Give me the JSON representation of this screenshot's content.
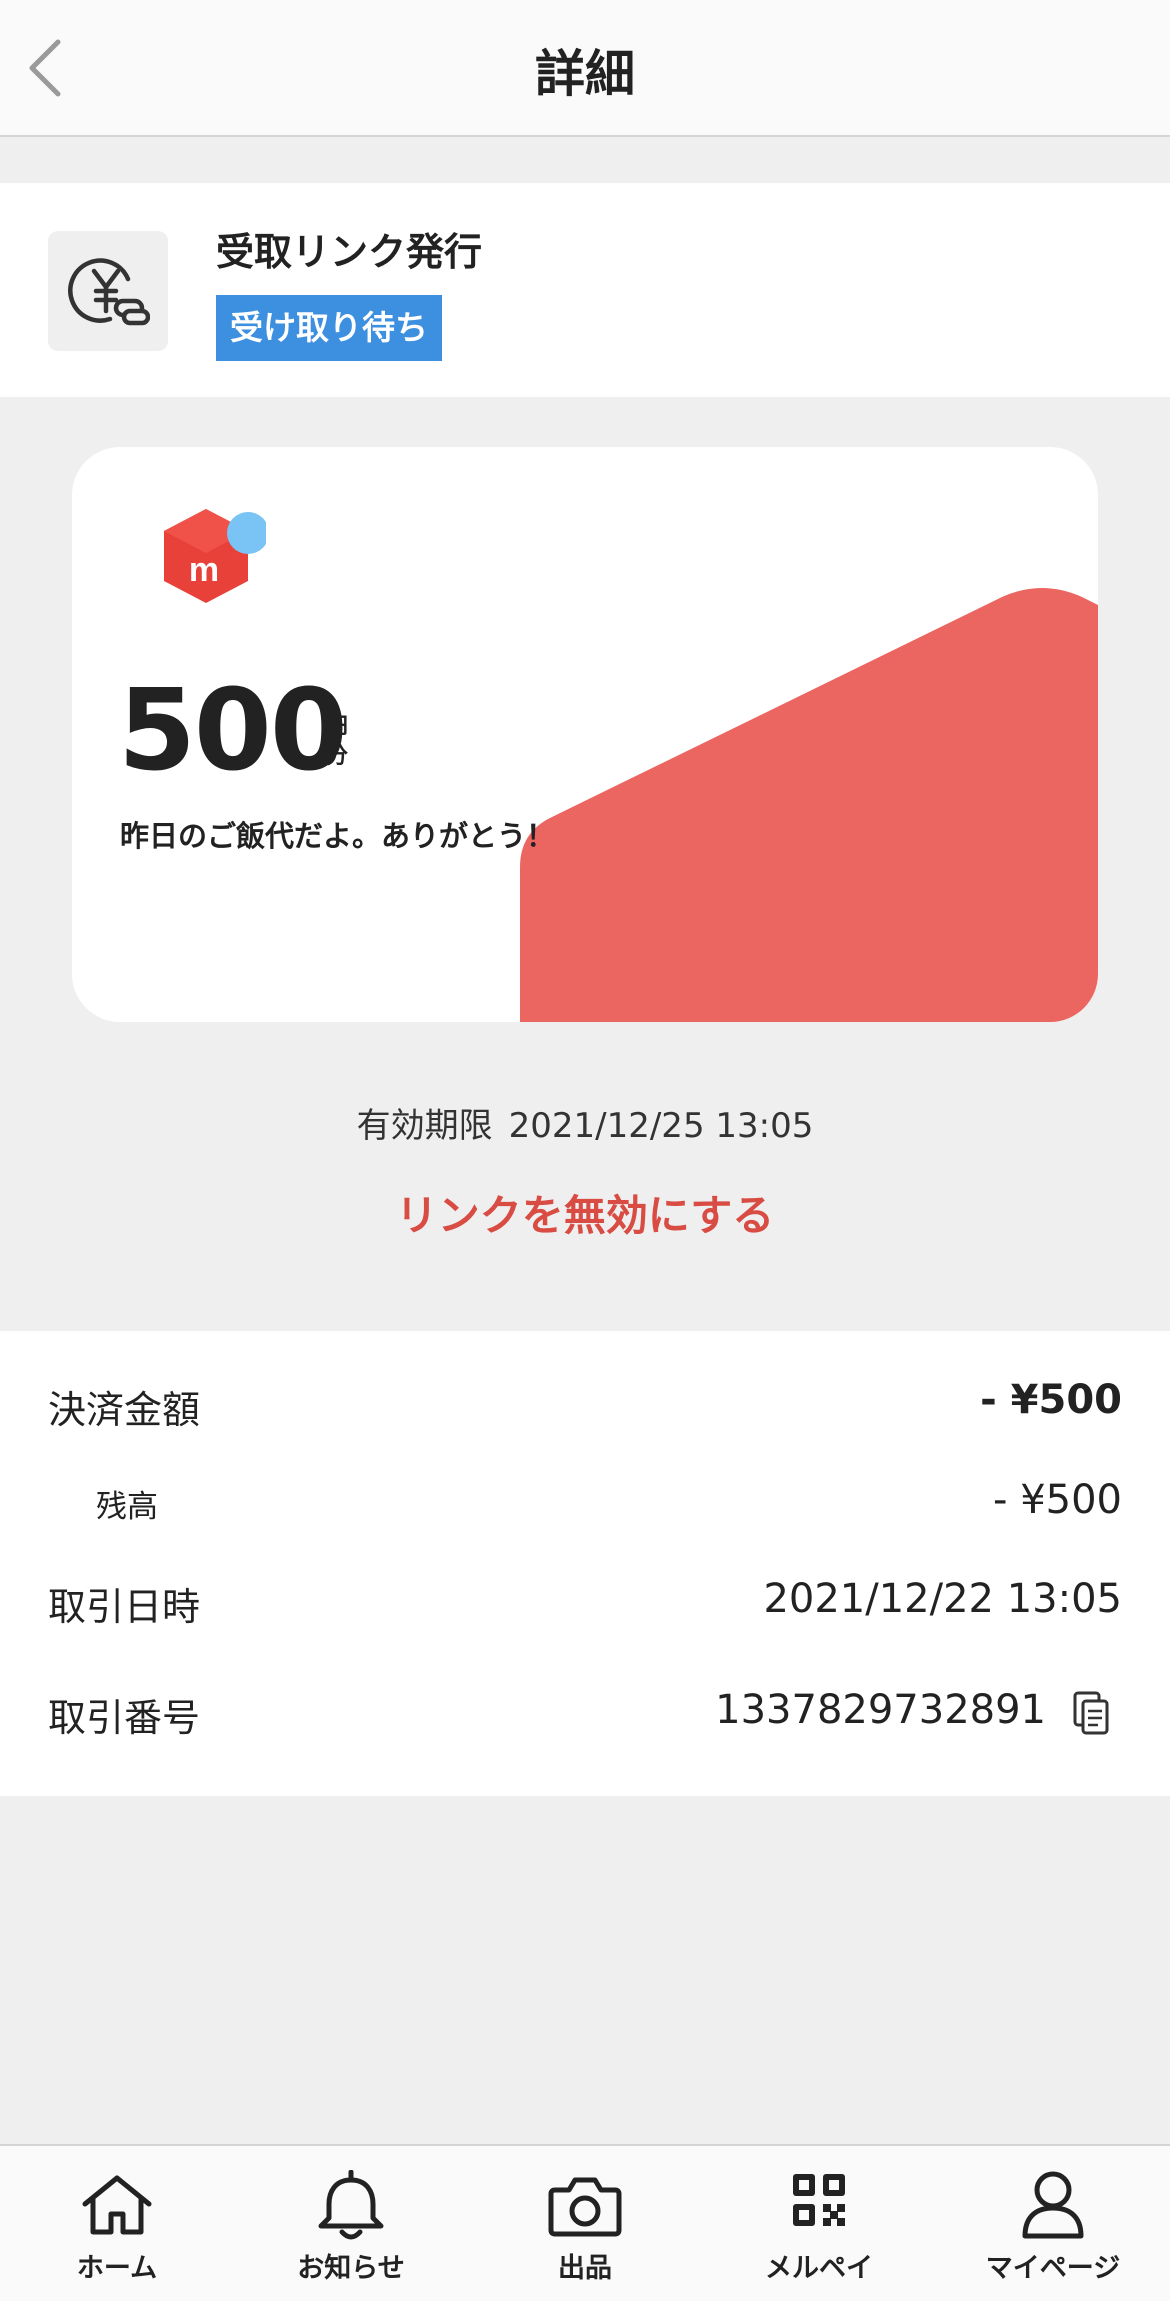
{
  "header": {
    "title": "詳細",
    "back_icon": "chevron-left-icon"
  },
  "transaction": {
    "icon": "yen-link-icon",
    "title": "受取リンク発行",
    "status_badge": "受け取り待ち",
    "badge_color": "#3d8fe0"
  },
  "card": {
    "logo": "mercari-box-logo",
    "amount": "500",
    "unit_top": "円",
    "unit_bottom": "分",
    "message": "昨日のご飯代だよ。ありがとう！",
    "accent_color": "#ec6661"
  },
  "expiry": {
    "label": "有効期限",
    "value": "2021/12/25 13:05"
  },
  "disable_link": {
    "label": "リンクを無効にする",
    "color": "#d84c44"
  },
  "details": {
    "payment_amount": {
      "label": "決済金額",
      "value": "- ¥500"
    },
    "balance": {
      "label": "残高",
      "value": "- ¥500"
    },
    "transaction_datetime": {
      "label": "取引日時",
      "value": "2021/12/22 13:05"
    },
    "transaction_number": {
      "label": "取引番号",
      "value": "1337829732891",
      "copy_icon": "copy-icon"
    }
  },
  "bottom_nav": {
    "items": [
      {
        "label": "ホーム",
        "icon": "home-icon"
      },
      {
        "label": "お知らせ",
        "icon": "bell-icon"
      },
      {
        "label": "出品",
        "icon": "camera-icon"
      },
      {
        "label": "メルペイ",
        "icon": "qr-code-icon"
      },
      {
        "label": "マイページ",
        "icon": "person-icon"
      }
    ]
  }
}
